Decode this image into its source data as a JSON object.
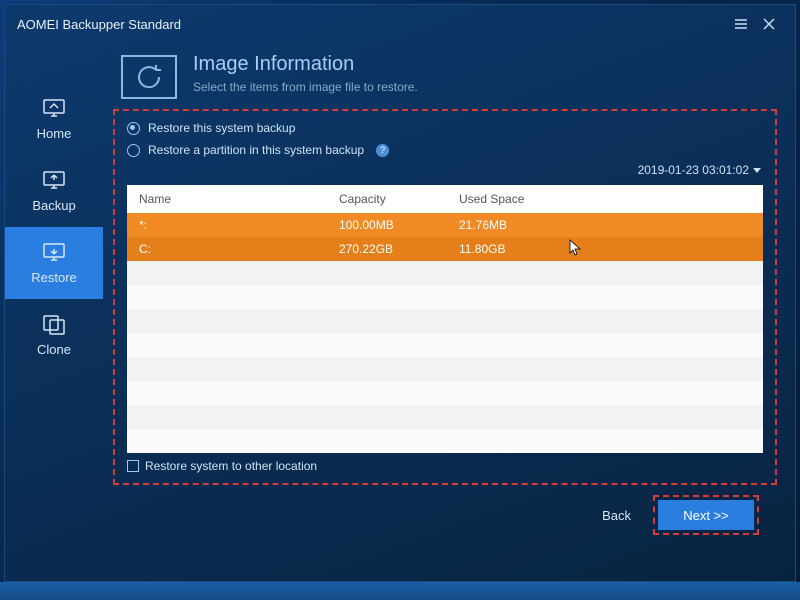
{
  "window": {
    "title": "AOMEI Backupper Standard"
  },
  "sidebar": {
    "items": [
      {
        "label": "Home"
      },
      {
        "label": "Backup"
      },
      {
        "label": "Restore"
      },
      {
        "label": "Clone"
      }
    ],
    "active": 2
  },
  "page": {
    "title": "Image Information",
    "subtitle": "Select the items from image file to restore."
  },
  "options": {
    "opt1": "Restore this system backup",
    "opt2": "Restore a partition in this system backup",
    "selected": 0
  },
  "timestamp": "2019-01-23 03:01:02",
  "table": {
    "headers": {
      "name": "Name",
      "capacity": "Capacity",
      "used": "Used Space"
    },
    "rows": [
      {
        "name": "*:",
        "capacity": "100.00MB",
        "used": "21.76MB"
      },
      {
        "name": "C:",
        "capacity": "270.22GB",
        "used": "11.80GB"
      }
    ]
  },
  "checkbox": {
    "label": "Restore system to other location"
  },
  "buttons": {
    "back": "Back",
    "next": "Next >>"
  }
}
